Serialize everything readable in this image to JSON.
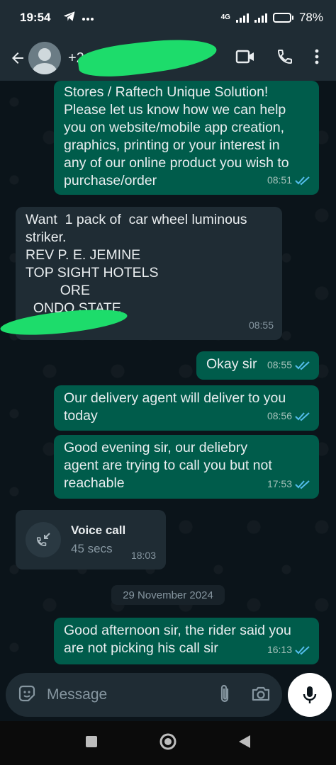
{
  "status_bar": {
    "time": "19:54",
    "network": "4G",
    "battery": "78%",
    "battery_level": 0.78
  },
  "header": {
    "contact_name": "+2"
  },
  "messages": [
    {
      "direction": "outgoing",
      "text": "Stores / Raftech Unique Solution!\nPlease let us know how we can help\nyou on website/mobile app creation,\ngraphics, printing or your interest in\nany of our online product you wish to\npurchase/order",
      "time": "08:51"
    },
    {
      "direction": "incoming",
      "text": "Want  1 pack of  car wheel luminous\nstriker.\nREV P. E. JEMINE\nTOP SIGHT HOTELS\n         ORE\n  ONDO STATE",
      "time": "08:55"
    },
    {
      "direction": "outgoing",
      "text": "Okay sir",
      "time": "08:55"
    },
    {
      "direction": "outgoing",
      "text": "Our delivery agent will deliver to you\ntoday",
      "time": "08:56"
    },
    {
      "direction": "outgoing",
      "text": "Good evening sir, our deliebry\nagent are trying to call you but not\nreachable",
      "time": "17:53"
    },
    {
      "direction": "outgoing",
      "text": "Good afternoon sir, the rider said you\nare not picking his call sir",
      "time": "16:13"
    }
  ],
  "voice_call": {
    "title": "Voice call",
    "duration": "45 secs",
    "time": "18:03"
  },
  "date_divider": "29 November 2024",
  "composer": {
    "placeholder": "Message"
  },
  "colors": {
    "outgoing_bubble": "#005c4b",
    "incoming_bubble": "#1f2c34",
    "read_ticks": "#53bdeb",
    "background": "#0b141a"
  }
}
